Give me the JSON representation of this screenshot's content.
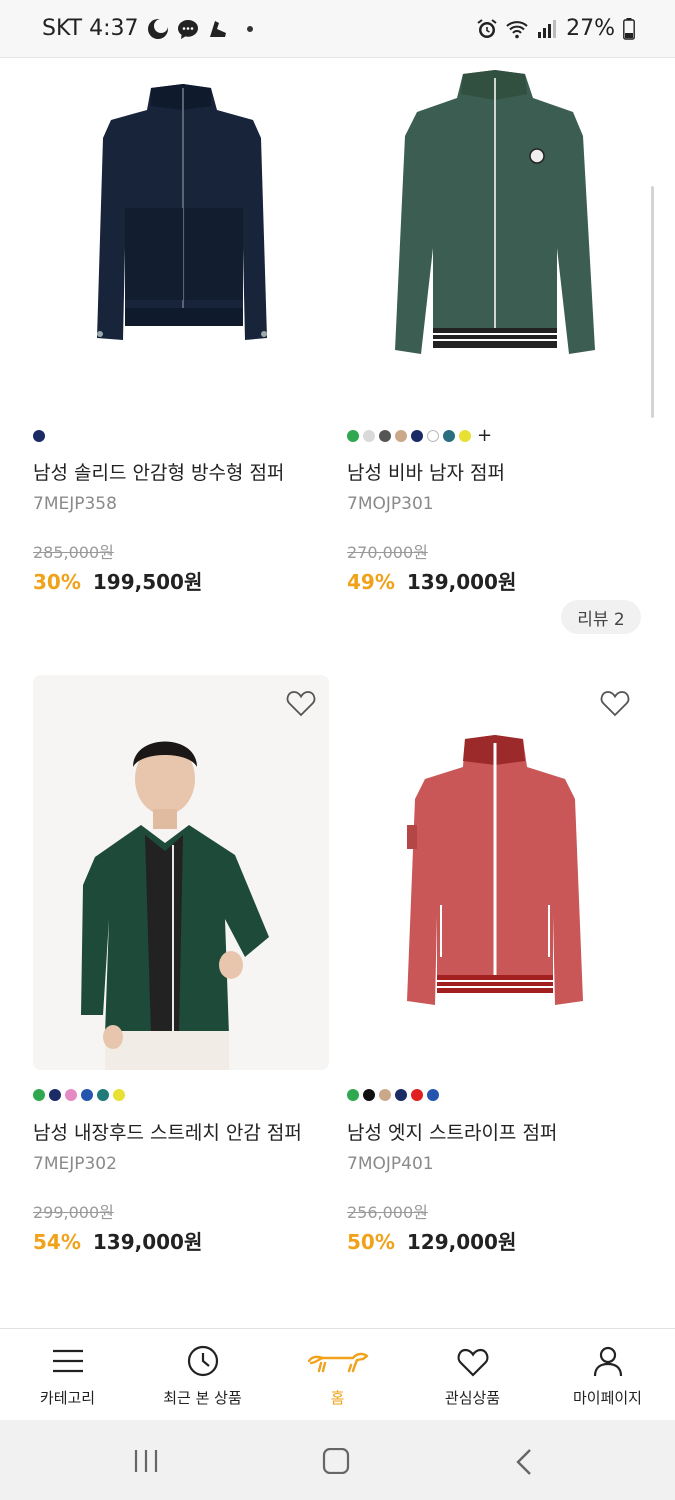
{
  "status_bar": {
    "carrier_time": "SKT 4:37",
    "battery": "27%",
    "icons_left": [
      "moon-icon",
      "chat-bubble-icon",
      "sneaker-icon",
      "dot-icon"
    ],
    "icons_right": [
      "alarm-icon",
      "wifi-icon",
      "signal-icon",
      "battery-icon"
    ]
  },
  "products": [
    {
      "name": "남성 솔리드 안감형 방수형 점퍼",
      "code": "7MEJP358",
      "original_price": "285,000원",
      "discount": "30%",
      "price": "199,500원",
      "swatches": [
        "#1b2b66"
      ],
      "more_swatches": false,
      "heart": false,
      "image": "navy-jacket"
    },
    {
      "name": "남성 비바 남자 점퍼",
      "code": "7MOJP301",
      "original_price": "270,000원",
      "discount": "49%",
      "price": "139,000원",
      "swatches": [
        "#2fa84f",
        "#d9d9d9",
        "#555555",
        "#c9a98a",
        "#1b2b66",
        "#ffffff",
        "#2a6f80",
        "#e8e033"
      ],
      "more_swatches": true,
      "more_symbol": "+",
      "review": "리뷰 2",
      "heart": false,
      "image": "green-jacket"
    },
    {
      "name": "남성 내장후드 스트레치 안감 점퍼",
      "code": "7MEJP302",
      "original_price": "299,000원",
      "discount": "54%",
      "price": "139,000원",
      "swatches": [
        "#2fa84f",
        "#1b2b66",
        "#e58ac3",
        "#2456b0",
        "#1f7a7a",
        "#e8e033"
      ],
      "more_swatches": false,
      "heart": true,
      "image": "model-green-jacket"
    },
    {
      "name": "남성 엣지 스트라이프 점퍼",
      "code": "7MOJP401",
      "original_price": "256,000원",
      "discount": "50%",
      "price": "129,000원",
      "swatches": [
        "#2fa84f",
        "#111111",
        "#c9a98a",
        "#1b2b66",
        "#e02020",
        "#2456b0"
      ],
      "more_swatches": false,
      "heart": true,
      "image": "red-jacket"
    }
  ],
  "bottom_nav": [
    {
      "label": "카테고리",
      "icon": "menu-icon",
      "active": false
    },
    {
      "label": "최근 본 상품",
      "icon": "clock-icon",
      "active": false
    },
    {
      "label": "홈",
      "icon": "dachshund-logo-icon",
      "active": true
    },
    {
      "label": "관심상품",
      "icon": "heart-icon",
      "active": false
    },
    {
      "label": "마이페이지",
      "icon": "person-icon",
      "active": false
    }
  ],
  "colors": {
    "accent": "#f0a21b",
    "text": "#222222",
    "muted": "#8a8a8a"
  }
}
